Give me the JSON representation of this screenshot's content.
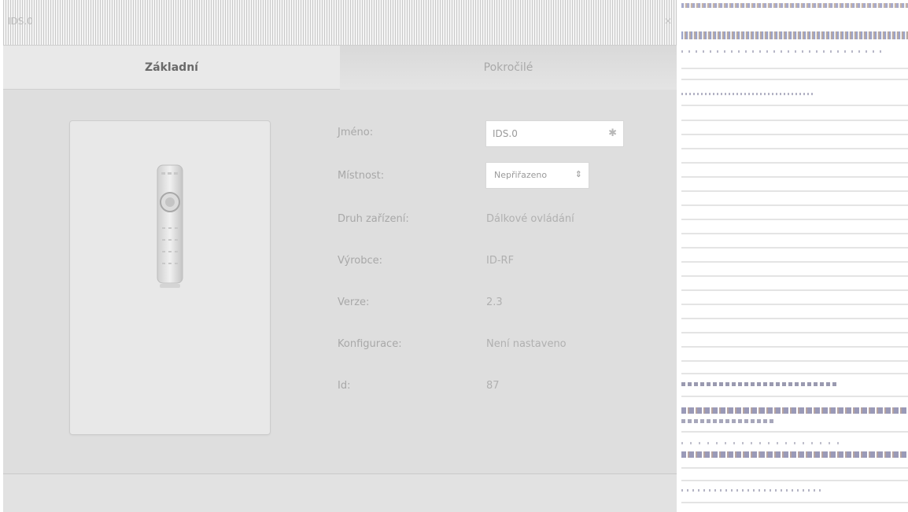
{
  "window": {
    "title": "IDS.0",
    "close_icon": "close-icon"
  },
  "tabs": [
    {
      "label": "Základní",
      "active": true
    },
    {
      "label": "Pokročilé",
      "active": false
    }
  ],
  "device_image": {
    "icon": "remote-control-icon"
  },
  "fields": {
    "name": {
      "label": "Jméno:",
      "value": "IDS.0",
      "icon": "edit-icon"
    },
    "room": {
      "label": "Místnost:",
      "value": "Nepřiřazeno",
      "icon": "updown-arrow-icon"
    },
    "type": {
      "label": "Druh zařízení:",
      "value": "Dálkové ovládání"
    },
    "manufacturer": {
      "label": "Výrobce:",
      "value": "ID-RF"
    },
    "version": {
      "label": "Verze:",
      "value": "2.3"
    },
    "configuration": {
      "label": "Konfigurace:",
      "value": "Není nastaveno"
    },
    "id": {
      "label": "Id:",
      "value": "87"
    }
  },
  "colors": {
    "dialog_bg": "#dedede",
    "panel_bg": "#e8e8e8",
    "label_text": "#a8a8a8"
  }
}
